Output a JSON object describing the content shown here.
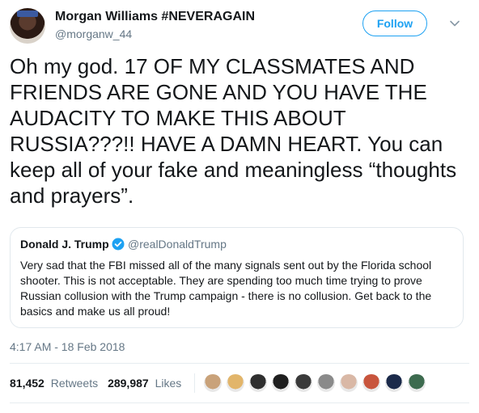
{
  "author": {
    "display_name": "Morgan Williams #NEVERAGAIN",
    "handle": "@morganw_44",
    "avatar_icon": "profile-photo-icon"
  },
  "follow_label": "Follow",
  "tweet_text": "Oh my god. 17 OF MY CLASSMATES AND FRIENDS ARE GONE AND YOU HAVE THE AUDACITY TO MAKE THIS ABOUT RUSSIA???!! HAVE A DAMN HEART. You can keep all of your fake and meaningless “thoughts and prayers”.",
  "quoted": {
    "name": "Donald J. Trump",
    "handle": "@realDonaldTrump",
    "verified_icon": "verified-badge-icon",
    "text": "Very sad that the FBI missed all of the many signals sent out by the Florida school shooter. This is not acceptable. They are spending too much time trying to prove Russian collusion with the Trump campaign - there is no collusion. Get back to the basics and make us all proud!"
  },
  "timestamp": "4:17 AM - 18 Feb 2018",
  "stats": {
    "retweets_count": "81,452",
    "retweets_label": "Retweets",
    "likes_count": "289,987",
    "likes_label": "Likes"
  },
  "likers": [
    {
      "icon": "liker-avatar-icon",
      "color": "#c9a27a"
    },
    {
      "icon": "liker-avatar-icon",
      "color": "#e2b56a"
    },
    {
      "icon": "liker-avatar-icon",
      "color": "#2f2f2f"
    },
    {
      "icon": "liker-avatar-icon",
      "color": "#1f1f1f"
    },
    {
      "icon": "liker-avatar-icon",
      "color": "#3a3a3a"
    },
    {
      "icon": "liker-avatar-icon",
      "color": "#8a8a8a"
    },
    {
      "icon": "liker-avatar-icon",
      "color": "#d9b8a6"
    },
    {
      "icon": "liker-avatar-icon",
      "color": "#c8553d"
    },
    {
      "icon": "liker-avatar-icon",
      "color": "#1b2a4a"
    },
    {
      "icon": "liker-avatar-icon",
      "color": "#3d6b4f"
    }
  ],
  "colors": {
    "accent": "#1da1f2",
    "secondary_text": "#657786",
    "border": "#e1e8ed"
  }
}
